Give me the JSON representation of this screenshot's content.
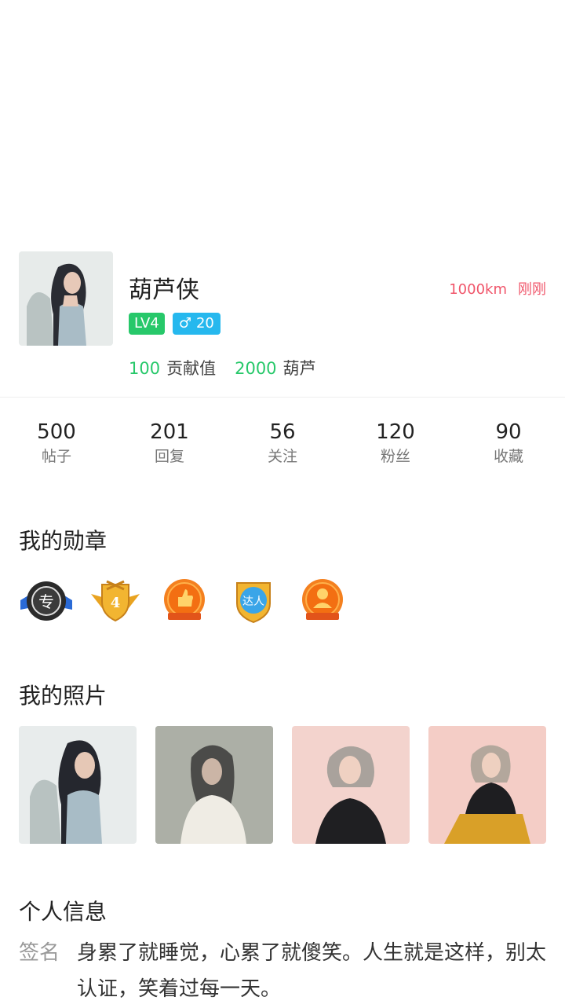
{
  "profile": {
    "name": "葫芦侠",
    "distance": "1000km",
    "last_seen": "刚刚",
    "level": "LV4",
    "gender_symbol": "♂",
    "age": "20",
    "contribution_value": "100",
    "contribution_label": "贡献值",
    "gourd_value": "2000",
    "gourd_label": "葫芦",
    "avatar_icon": "woman-portrait-photo"
  },
  "counters": [
    {
      "value": "500",
      "label": "帖子"
    },
    {
      "value": "201",
      "label": "回复"
    },
    {
      "value": "56",
      "label": "关注"
    },
    {
      "value": "120",
      "label": "粉丝"
    },
    {
      "value": "90",
      "label": "收藏"
    }
  ],
  "medals": {
    "title": "我的勋章",
    "items": [
      {
        "icon": "expert-medal-icon",
        "text": "专"
      },
      {
        "icon": "level-4-shield-icon",
        "text": "4"
      },
      {
        "icon": "thumbs-up-medal-icon"
      },
      {
        "icon": "master-medal-icon",
        "text": "达人"
      },
      {
        "icon": "person-star-medal-icon"
      }
    ]
  },
  "photos": {
    "title": "我的照片",
    "items": [
      "woman-silver-dress-photo",
      "woman-blurred-glass-photo",
      "woman-black-top-photo",
      "woman-seated-photo"
    ]
  },
  "personal_info": {
    "title": "个人信息",
    "signature_label": "签名",
    "signature": "身累了就睡觉，心累了就傻笑。人生就是这样，别太认证，笑着过每一天。"
  },
  "colors": {
    "accent_green": "#27c86a",
    "accent_blue": "#26b8ee",
    "accent_red": "#f0556a"
  }
}
